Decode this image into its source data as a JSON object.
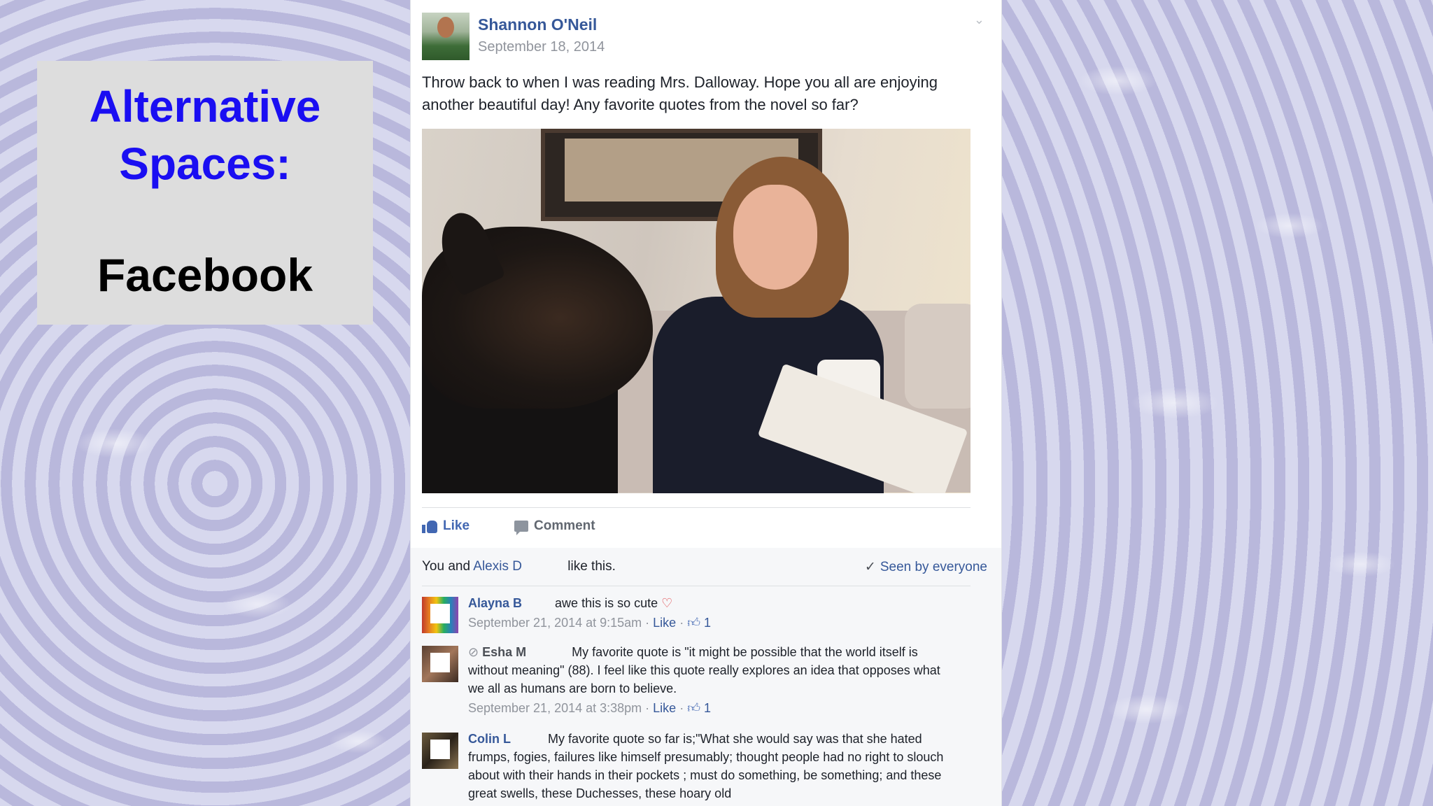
{
  "slide": {
    "title_line1": "Alternative",
    "title_line2": "Spaces:",
    "subtitle": "Facebook"
  },
  "post": {
    "author": "Shannon O'Neil",
    "date": "September 18, 2014",
    "text": "Throw back to when I was reading Mrs. Dalloway. Hope you all are enjoying another beautiful day! Any favorite quotes from the novel so far?",
    "actions": {
      "like": "Like",
      "comment": "Comment"
    },
    "likes": {
      "prefix": "You and",
      "name": "Alexis D",
      "suffix": "like this."
    },
    "seen": "Seen by everyone"
  },
  "comments": [
    {
      "name": "Alayna B",
      "text": "awe this is so cute",
      "date": "September 21, 2014 at 9:15am",
      "like_label": "Like",
      "like_count": "1"
    },
    {
      "name": "Esha M",
      "text": "My favorite quote is \"it might be possible that the world itself is without meaning\" (88). I feel like this quote really explores an idea that opposes what we all as humans are born to believe.",
      "date": "September 21, 2014 at 3:38pm",
      "like_label": "Like",
      "like_count": "1"
    },
    {
      "name": "Colin L",
      "text": "My favorite quote so far is;\"What she would say was that she hated frumps, fogies, failures like himself presumably; thought people had no right to slouch about with their hands in their pockets ; must do something, be something; and these great swells, these Duchesses, these hoary old"
    }
  ],
  "colors": {
    "title_blue": "#1a0ef2",
    "fb_link": "#365899",
    "fb_like_blue": "#4267b2"
  },
  "icons": [
    "chevron-down-icon",
    "like-thumb-icon",
    "comment-bubble-icon",
    "check-icon",
    "heart-icon",
    "globe-icon"
  ]
}
